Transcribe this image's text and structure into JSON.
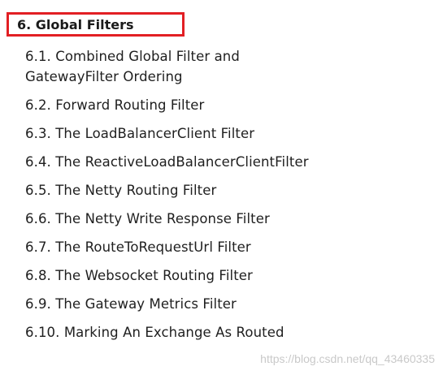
{
  "section": {
    "title": "6. Global Filters"
  },
  "toc": {
    "items": [
      {
        "label": "6.1. Combined Global Filter and GatewayFilter Ordering"
      },
      {
        "label": "6.2. Forward Routing Filter"
      },
      {
        "label": "6.3. The LoadBalancerClient Filter"
      },
      {
        "label": "6.4. The ReactiveLoadBalancerClientFilter"
      },
      {
        "label": "6.5. The Netty Routing Filter"
      },
      {
        "label": "6.6. The Netty Write Response Filter"
      },
      {
        "label": "6.7. The RouteToRequestUrl Filter"
      },
      {
        "label": "6.8. The Websocket Routing Filter"
      },
      {
        "label": "6.9. The Gateway Metrics Filter"
      },
      {
        "label": "6.10. Marking An Exchange As Routed"
      }
    ]
  },
  "watermark": {
    "text": "https://blog.csdn.net/qq_43460335"
  },
  "colors": {
    "highlight_border": "#e21f24",
    "text": "#1f1f1f",
    "watermark": "#c9c9c9"
  }
}
